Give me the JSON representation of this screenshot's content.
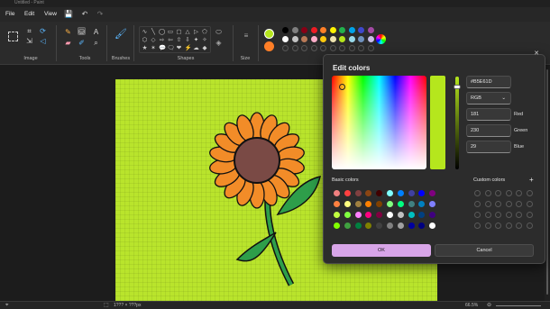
{
  "window": {
    "title": "Untitled - Paint"
  },
  "menu": {
    "file": "File",
    "edit": "Edit",
    "view": "View"
  },
  "ribbon": {
    "groups": {
      "image": "Image",
      "tools": "Tools",
      "brushes": "Brushes",
      "shapes": "Shapes",
      "size": "Size"
    },
    "shape_glyphs": [
      "∿",
      "╲",
      "◯",
      "▭",
      "▢",
      "△",
      "▷",
      "⬠",
      "⬡",
      "◇",
      "⇨",
      "⇦",
      "⇧",
      "⇩",
      "✦",
      "✧",
      "★",
      "✶",
      "💬",
      "🗨",
      "❤",
      "⚡",
      "☁",
      "◆"
    ],
    "palette_top": [
      "#000000",
      "#7f7f7f",
      "#880015",
      "#ed1c24",
      "#ff7f27",
      "#fff200",
      "#22b14c",
      "#00a2e8",
      "#3f48cc",
      "#a349a4"
    ],
    "palette_mid": [
      "#ffffff",
      "#c3c3c3",
      "#b97a57",
      "#ffaec9",
      "#ffc90e",
      "#efe4b0",
      "#b5e61d",
      "#99d9ea",
      "#7092be",
      "#c8bfe7"
    ],
    "palette_bot": [
      "#2d2d2d",
      "#2d2d2d",
      "#2d2d2d",
      "#2d2d2d",
      "#2d2d2d",
      "#2d2d2d",
      "#2d2d2d",
      "#2d2d2d",
      "#2d2d2d",
      "#2d2d2d"
    ],
    "color1": "#b5e61d",
    "color2": "#ff7f27"
  },
  "status": {
    "dimensions": "1??? × ???px",
    "zoom": "66.5%"
  },
  "dialog": {
    "title": "Edit colors",
    "close": "✕",
    "hex": "#B5E61D",
    "mode": "RGB",
    "red_value": "181",
    "green_value": "230",
    "blue_value": "29",
    "red_label": "Red",
    "green_label": "Green",
    "blue_label": "Blue",
    "basic_colors_title": "Basic colors",
    "custom_colors_title": "Custom colors",
    "add_custom": "+",
    "ok": "OK",
    "cancel": "Cancel",
    "basic_colors": [
      "#f08080",
      "#ff4040",
      "#804040",
      "#8b4513",
      "#400000",
      "#80ffff",
      "#0080ff",
      "#4040a0",
      "#0000ff",
      "#800080",
      "#ff8040",
      "#ffff80",
      "#a08040",
      "#ff8000",
      "#804000",
      "#80ff80",
      "#00ff80",
      "#408080",
      "#0080c0",
      "#8080ff",
      "#c0ff40",
      "#80ff40",
      "#ff80ff",
      "#ff0080",
      "#800040",
      "#ffffff",
      "#c0c0c0",
      "#00c0c0",
      "#004080",
      "#400080",
      "#80ff00",
      "#40a040",
      "#008040",
      "#808000",
      "#404040",
      "#808080",
      "#a0a0a0",
      "#0000a0",
      "#000080",
      "#ffffff"
    ],
    "custom_colors_count": 24
  },
  "colors": {
    "canvas": "#b9e42c",
    "accent": "#d8a5e8"
  }
}
